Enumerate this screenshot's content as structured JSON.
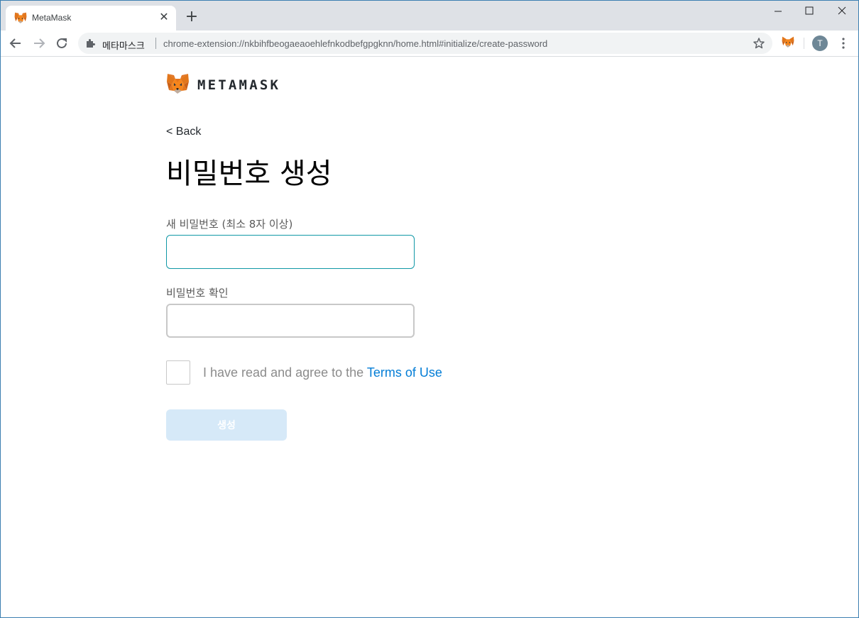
{
  "browser": {
    "tab": {
      "title": "MetaMask",
      "icon": "metamask-fox-icon"
    },
    "toolbar": {
      "site_name": "메타마스크",
      "url": "chrome-extension://nkbihfbeogaeaoehlefnkodbefgpgknn/home.html#initialize/create-password",
      "profile_initial": "T"
    }
  },
  "page": {
    "logo_text": "METAMASK",
    "back_label": "< Back",
    "title": "비밀번호 생성",
    "new_password_label": "새 비밀번호 (최소 8자 이상)",
    "new_password_value": "",
    "confirm_password_label": "비밀번호 확인",
    "confirm_password_value": "",
    "agree_text": "I have read and agree to the ",
    "terms_link": "Terms of Use",
    "agree_checked": false,
    "create_button": "생성",
    "create_button_enabled": false
  },
  "colors": {
    "link": "#037dd6",
    "button_disabled_bg": "#d6e9f8",
    "input_focus_border": "#1098a6",
    "tabstrip_bg": "#dee1e6",
    "fox_orange": "#e2761b"
  }
}
